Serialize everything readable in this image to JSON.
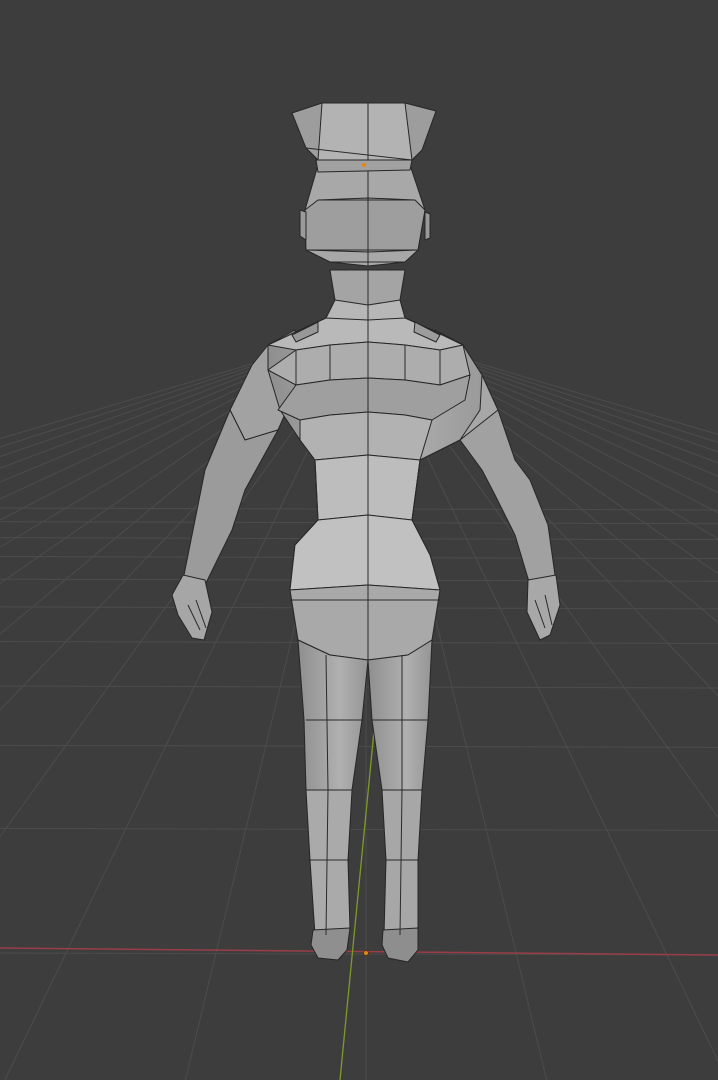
{
  "viewport": {
    "mode": "object",
    "shading": "solid",
    "overlays": {
      "grid_floor": true,
      "x_axis_color": "#9a3d48",
      "y_axis_color": "#7f9a2b",
      "grid_color": "#4c4c4c"
    },
    "background_color": "#3d3d3d"
  },
  "scene": {
    "object": {
      "name": "",
      "type": "mesh",
      "subject": "low-poly-character-uniform-back-view",
      "shading_color": "#a9a9a9",
      "wire_color": "#1e1e1e",
      "origin_color": "#e08a1e"
    }
  }
}
